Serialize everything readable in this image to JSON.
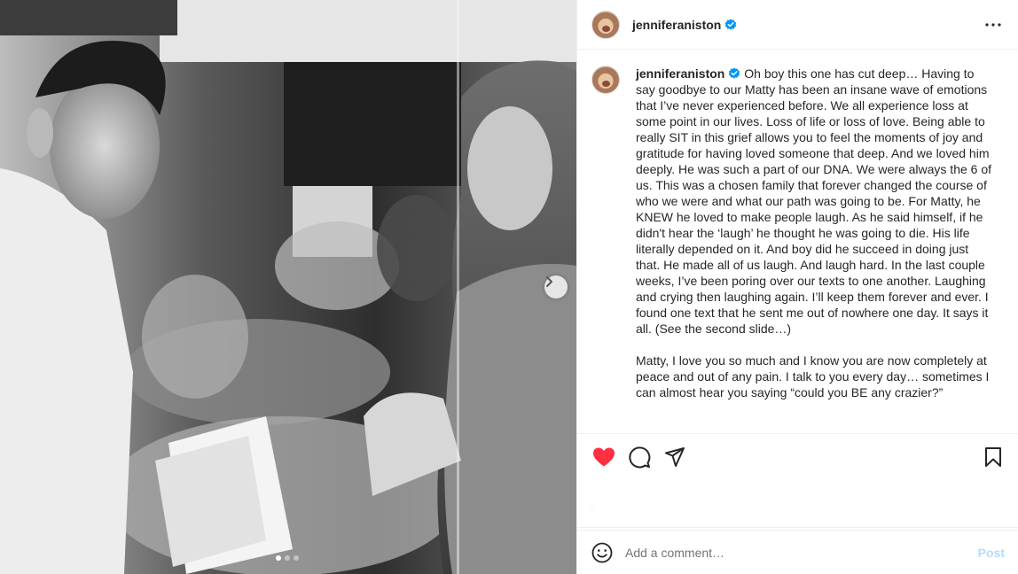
{
  "post": {
    "username": "jenniferaniston",
    "verified": true,
    "caption_paragraphs": [
      "Oh boy this one has cut deep… Having to say goodbye to our Matty has been an insane wave of emotions that I’ve never experienced before. We all experience loss at some point in our lives. Loss of life or loss of love. Being able to really SIT in this grief allows you to feel the moments of joy and gratitude for having loved someone that deep. And we loved him deeply. He was such a part of our DNA. We were always the 6 of us. This was a chosen family that forever changed the course of who we were and what our path was going to be. For Matty, he KNEW he loved to make people laugh. As he said himself, if he didn't hear the ‘laugh’ he thought he was going to die. His life literally depended on it. And boy did he succeed in doing just that. He made all of us laugh. And laugh hard. In the last couple weeks, I’ve been poring over our texts to one another. Laughing and crying then laughing again. I’ll keep them forever and ever. I found one text that he sent me out of nowhere one day. It says it all. (See the second slide…)",
      "Matty, I love you so much and I know you are now completely at peace and out of any pain. I talk to you every day… sometimes I can almost hear you saying “could you BE any crazier?”"
    ],
    "likes_text": ".",
    "carousel": {
      "total_slides": 3,
      "active_slide": 1
    }
  },
  "comment": {
    "placeholder": "Add a comment…",
    "post_label": "Post"
  },
  "icons": {
    "more": "more-horizontal-icon",
    "like": "heart-filled-icon",
    "comment": "comment-icon",
    "share": "share-icon",
    "save": "bookmark-icon",
    "emoji": "emoji-icon",
    "next": "chevron-right-icon",
    "verified": "verified-badge-icon"
  },
  "colors": {
    "like_red": "#ff3040",
    "verified_blue": "#0095f6",
    "post_disabled": "#b3dbff"
  }
}
